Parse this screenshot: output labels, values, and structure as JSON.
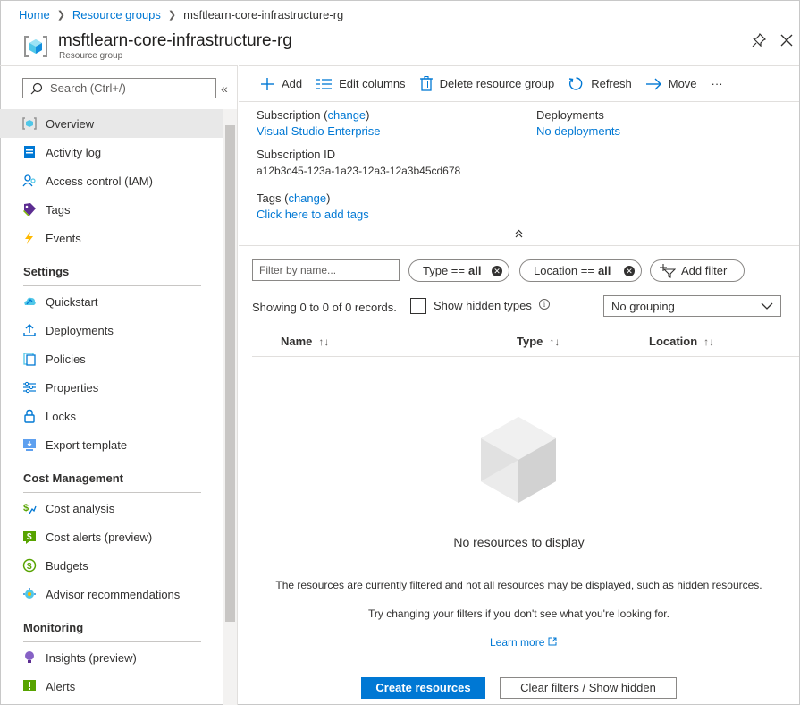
{
  "breadcrumb": {
    "home": "Home",
    "resource_groups": "Resource groups",
    "current": "msftlearn-core-infrastructure-rg"
  },
  "header": {
    "title": "msftlearn-core-infrastructure-rg",
    "subtitle": "Resource group",
    "icons": [
      "resource-group-icon",
      "pin-icon",
      "close-icon"
    ]
  },
  "sidebar": {
    "search_placeholder": "Search (Ctrl+/)",
    "collapse_glyph": "«",
    "items": [
      {
        "label": "Overview",
        "icon": "overview-icon",
        "active": true
      },
      {
        "label": "Activity log",
        "icon": "activity-log-icon"
      },
      {
        "label": "Access control (IAM)",
        "icon": "access-control-icon"
      },
      {
        "label": "Tags",
        "icon": "tag-icon"
      },
      {
        "label": "Events",
        "icon": "lightning-icon"
      }
    ],
    "settings_header": "Settings",
    "settings_items": [
      {
        "label": "Quickstart",
        "icon": "quickstart-icon"
      },
      {
        "label": "Deployments",
        "icon": "deployments-icon"
      },
      {
        "label": "Policies",
        "icon": "policies-icon"
      },
      {
        "label": "Properties",
        "icon": "properties-icon"
      },
      {
        "label": "Locks",
        "icon": "lock-icon"
      },
      {
        "label": "Export template",
        "icon": "export-template-icon"
      }
    ],
    "cost_header": "Cost Management",
    "cost_items": [
      {
        "label": "Cost analysis",
        "icon": "cost-analysis-icon"
      },
      {
        "label": "Cost alerts (preview)",
        "icon": "cost-alerts-icon"
      },
      {
        "label": "Budgets",
        "icon": "budgets-icon"
      },
      {
        "label": "Advisor recommendations",
        "icon": "advisor-icon"
      }
    ],
    "monitoring_header": "Monitoring",
    "monitoring_items": [
      {
        "label": "Insights (preview)",
        "icon": "insights-icon"
      },
      {
        "label": "Alerts",
        "icon": "alerts-icon"
      }
    ]
  },
  "toolbar": {
    "add": "Add",
    "edit_columns": "Edit columns",
    "delete": "Delete resource group",
    "refresh": "Refresh",
    "move": "Move",
    "more": "···"
  },
  "essentials": {
    "subscription_label": "Subscription",
    "change": "change",
    "subscription_value": "Visual Studio Enterprise",
    "subscription_id_label": "Subscription ID",
    "subscription_id": "a12b3c45-123a-1a23-12a3-12a3b45cd678",
    "tags_label": "Tags",
    "tags_link": "Click here to add tags",
    "deployments_label": "Deployments",
    "deployments_value": "No deployments"
  },
  "filters": {
    "name_placeholder": "Filter by name...",
    "type_label": "Type ==",
    "type_value": "all",
    "location_label": "Location ==",
    "location_value": "all",
    "add_filter": "Add filter"
  },
  "list": {
    "records": "Showing 0 to 0 of 0 records.",
    "show_hidden": "Show hidden types",
    "grouping": "No grouping",
    "columns": [
      "Name",
      "Type",
      "Location"
    ],
    "sort_glyph": "↑↓"
  },
  "empty": {
    "title": "No resources to display",
    "message1": "The resources are currently filtered and not all resources may be displayed, such as hidden resources.",
    "message2": "Try changing your filters if you don't see what you're looking for.",
    "learn_more": "Learn more"
  },
  "buttons": {
    "create": "Create resources",
    "clear": "Clear filters / Show hidden"
  }
}
